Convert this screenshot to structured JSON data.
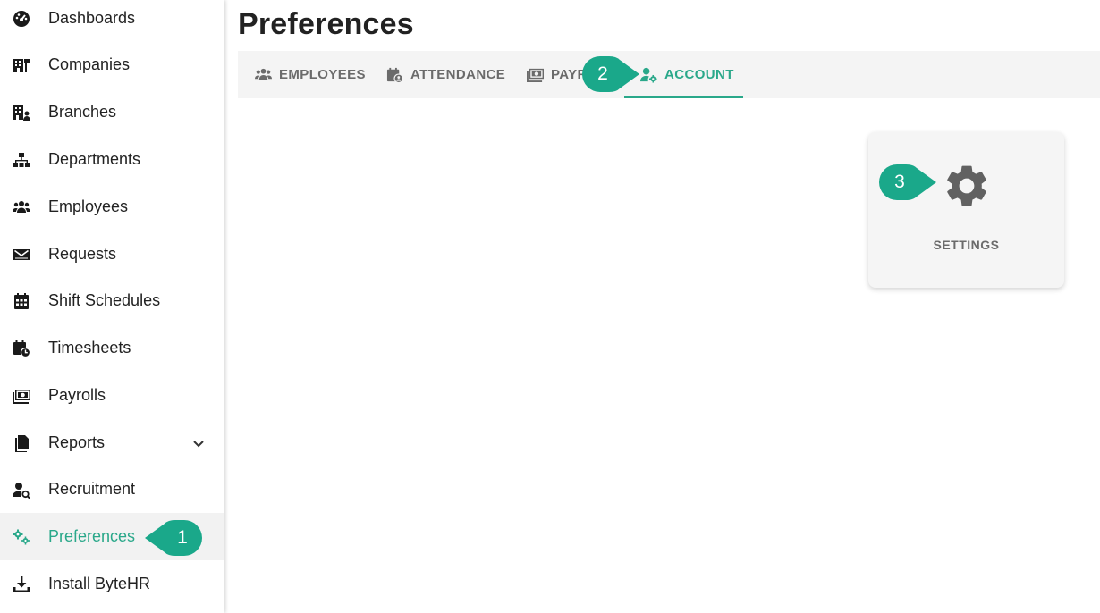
{
  "page": {
    "title": "Preferences"
  },
  "sidebar": {
    "items": [
      {
        "label": "Dashboards",
        "icon": "dashboard-icon"
      },
      {
        "label": "Companies",
        "icon": "building-icon"
      },
      {
        "label": "Branches",
        "icon": "branch-icon"
      },
      {
        "label": "Departments",
        "icon": "sitemap-icon"
      },
      {
        "label": "Employees",
        "icon": "users-icon"
      },
      {
        "label": "Requests",
        "icon": "envelope-icon"
      },
      {
        "label": "Shift Schedules",
        "icon": "calendar-icon"
      },
      {
        "label": "Timesheets",
        "icon": "calendar-clock-icon"
      },
      {
        "label": "Payrolls",
        "icon": "money-icon"
      },
      {
        "label": "Reports",
        "icon": "document-icon"
      },
      {
        "label": "Recruitment",
        "icon": "user-search-icon"
      },
      {
        "label": "Preferences",
        "icon": "gears-icon",
        "active": true
      },
      {
        "label": "Install ByteHR",
        "icon": "download-icon"
      }
    ]
  },
  "tabs": [
    {
      "label": "EMPLOYEES",
      "icon": "users-icon"
    },
    {
      "label": "ATTENDANCE",
      "icon": "calendar-user-icon"
    },
    {
      "label": "PAYROLL",
      "icon": "money-icon"
    },
    {
      "label": "ACCOUNT",
      "icon": "user-gear-icon",
      "active": true
    }
  ],
  "card": {
    "label": "SETTINGS",
    "icon": "gear-icon"
  },
  "callouts": [
    "1",
    "2",
    "3"
  ],
  "colors": {
    "accent": "#2aa88a",
    "callout": "#1aa88a",
    "text": "#222222",
    "muted": "#6b6b6b"
  }
}
